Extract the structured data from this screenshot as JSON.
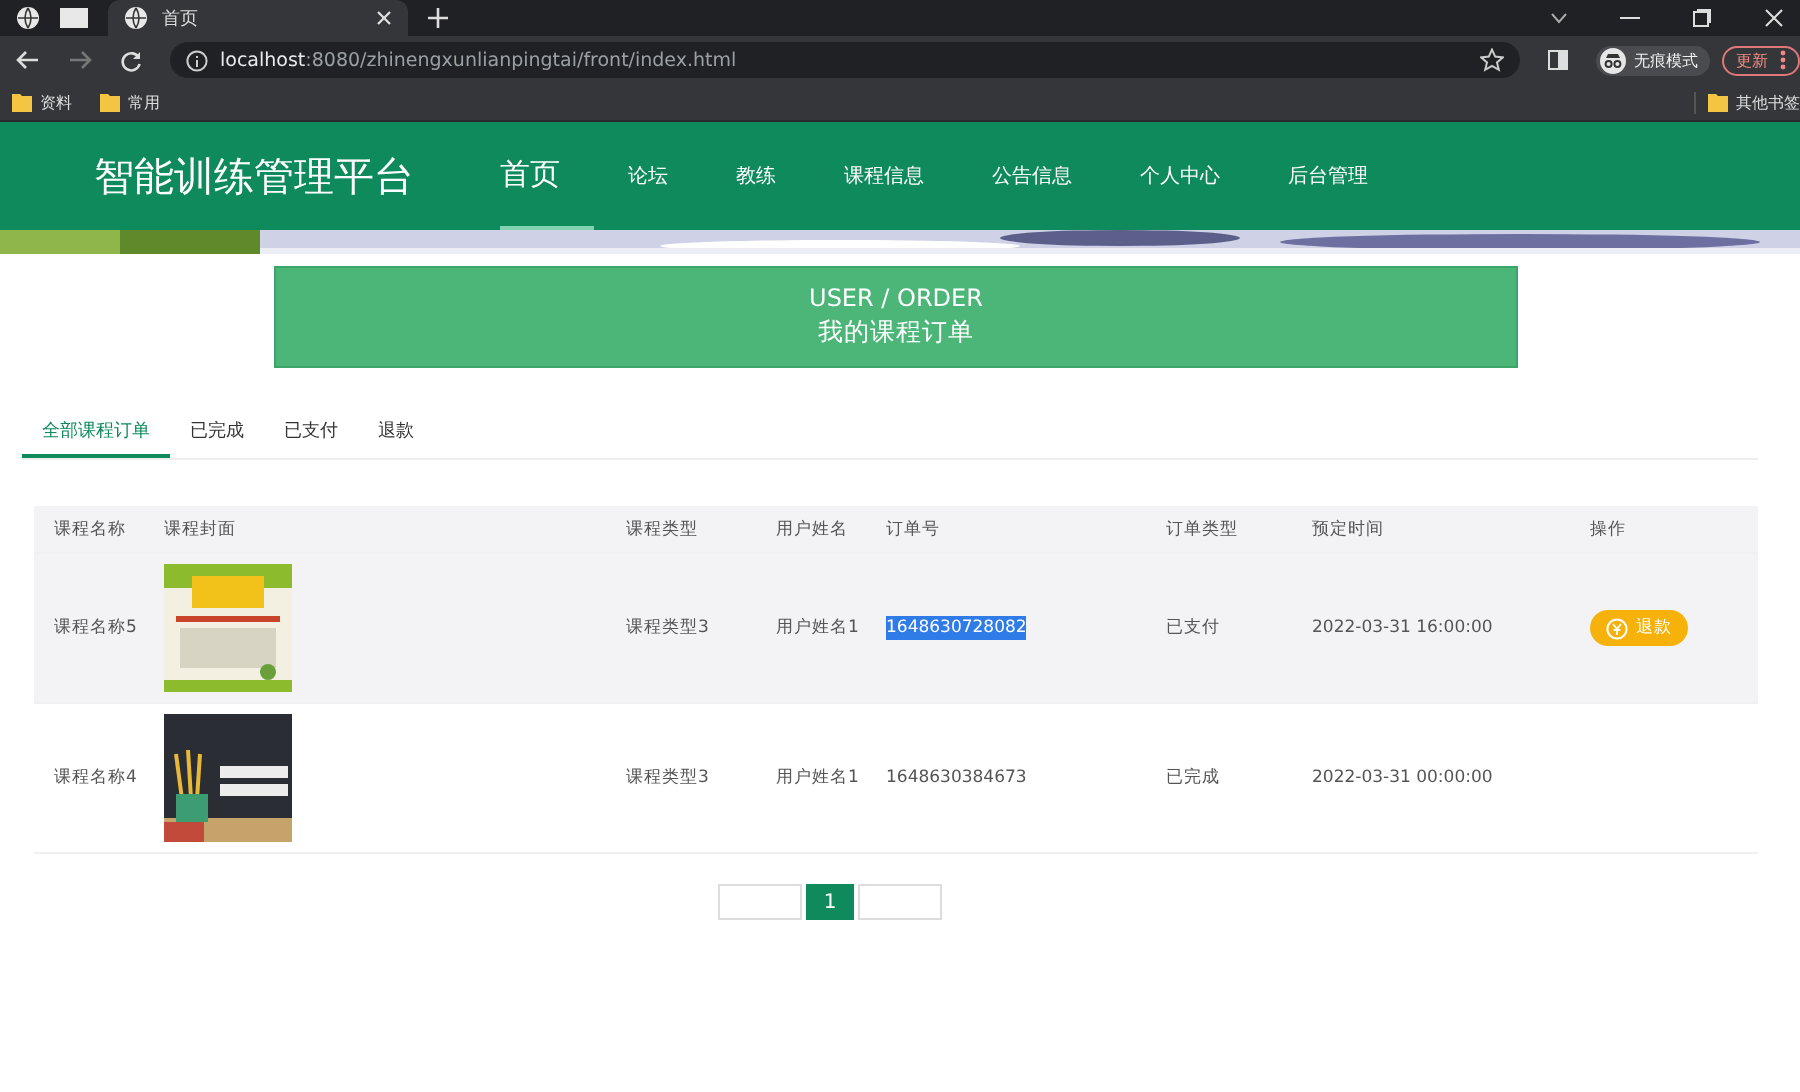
{
  "browser": {
    "tab_title": "首页",
    "url_host": "localhost",
    "url_rest": ":8080/zhinengxunlianpingtai/front/index.html",
    "incognito_label": "无痕模式",
    "update_label": "更新",
    "bookmarks": [
      "资料",
      "常用"
    ],
    "other_bookmarks": "其他书签"
  },
  "header": {
    "title": "智能训练管理平台",
    "nav": [
      {
        "label": "首页",
        "selected": true
      },
      {
        "label": "论坛",
        "selected": false
      },
      {
        "label": "教练",
        "selected": false
      },
      {
        "label": "课程信息",
        "selected": false
      },
      {
        "label": "公告信息",
        "selected": false
      },
      {
        "label": "个人中心",
        "selected": false
      },
      {
        "label": "后台管理",
        "selected": false
      }
    ]
  },
  "banner": {
    "kind": "picture"
  },
  "title_card": {
    "line_1": "USER / ORDER",
    "line_2": "我的课程订单"
  },
  "tabs": [
    {
      "label": "全部课程订单",
      "selected": true
    },
    {
      "label": "已完成",
      "selected": false
    },
    {
      "label": "已支付",
      "selected": false
    },
    {
      "label": "退款",
      "selected": false
    }
  ],
  "table": {
    "columns": [
      "课程名称",
      "课程封面",
      "课程类型",
      "用户姓名",
      "订单号",
      "订单类型",
      "预定时间",
      "操作"
    ],
    "rows": [
      {
        "name": "课程名称5",
        "cover": {
          "kind": "picture"
        },
        "type": "课程类型3",
        "user": "用户姓名1",
        "order_no": "1648630728082",
        "order_no_selected": true,
        "order_type": "已支付",
        "time": "2022-03-31 16:00:00",
        "hovered": true,
        "actions": [
          {
            "label": "退款"
          }
        ]
      },
      {
        "name": "课程名称4",
        "cover": {
          "kind": "picture"
        },
        "type": "课程类型3",
        "user": "用户姓名1",
        "order_no": "1648630384673",
        "order_no_selected": false,
        "order_type": "已完成",
        "time": "2022-03-31 00:00:00",
        "hovered": false,
        "actions": []
      }
    ]
  },
  "pagination": {
    "pages": [
      {
        "label": "1",
        "selected": true
      }
    ]
  }
}
